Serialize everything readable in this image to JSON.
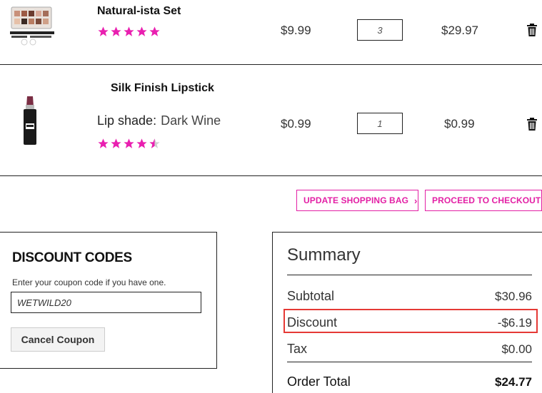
{
  "cart": {
    "items": [
      {
        "name": "Natural-ista Set",
        "unit_price": "$9.99",
        "quantity": "3",
        "line_total": "$29.97",
        "rating": 5
      },
      {
        "name": "Silk Finish Lipstick",
        "shade_label": "Lip shade:",
        "shade_value": "Dark Wine",
        "unit_price": "$0.99",
        "quantity": "1",
        "line_total": "$0.99",
        "rating": 4.5
      }
    ]
  },
  "actions": {
    "update_bag": "UPDATE SHOPPING BAG",
    "checkout": "PROCEED TO CHECKOUT"
  },
  "discount": {
    "title": "DISCOUNT CODES",
    "hint": "Enter your coupon code if you have one.",
    "coupon_value": "WETWILD20",
    "cancel_label": "Cancel Coupon"
  },
  "summary": {
    "title": "Summary",
    "subtotal_label": "Subtotal",
    "subtotal_value": "$30.96",
    "discount_label": "Discount",
    "discount_value": "-$6.19",
    "tax_label": "Tax",
    "tax_value": "$0.00",
    "order_total_label": "Order Total",
    "order_total_value": "$24.77"
  },
  "colors": {
    "accent": "#e320a5",
    "star": "#e91fb0",
    "highlight": "#e53935"
  }
}
